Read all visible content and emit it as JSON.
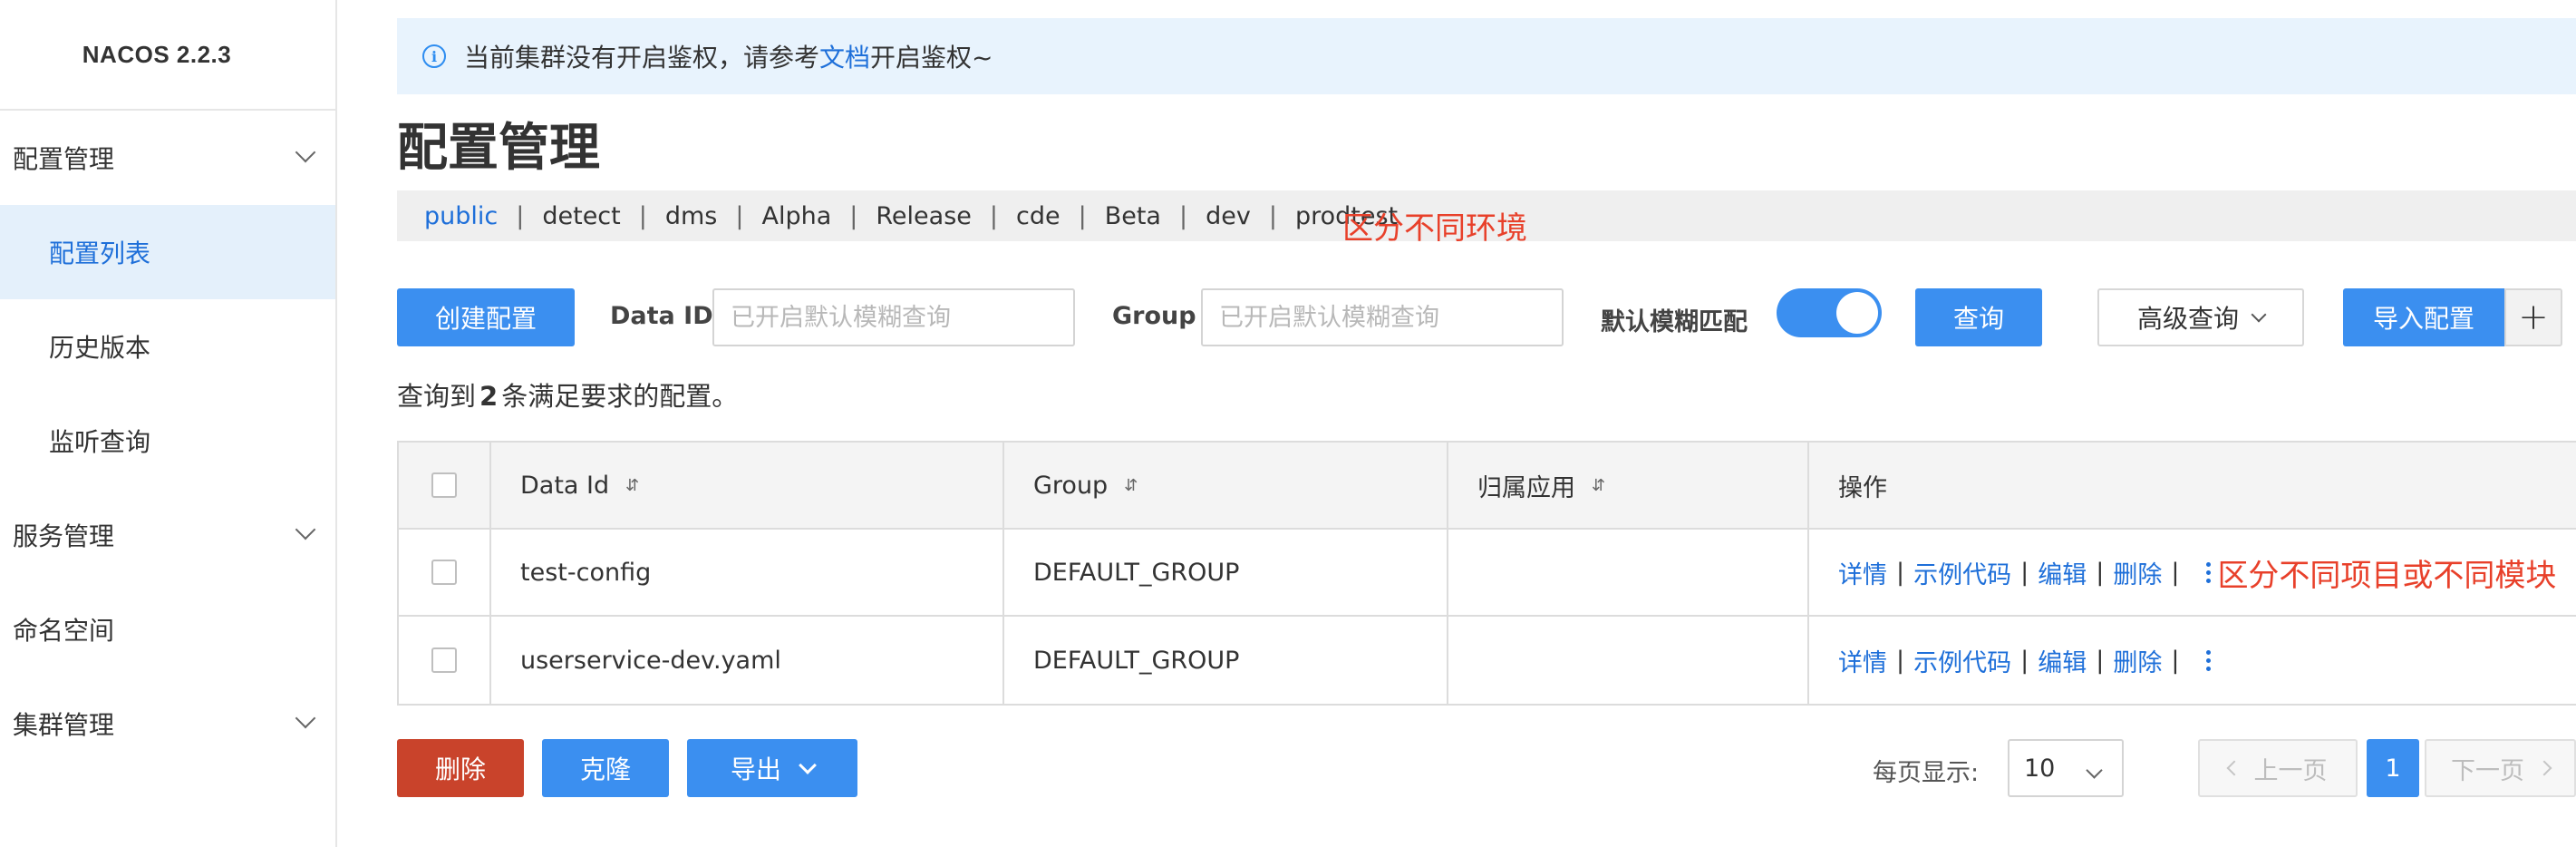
{
  "app": {
    "brand": "NACOS 2.2.3"
  },
  "sidebar": {
    "items": [
      {
        "label": "配置管理",
        "type": "group",
        "expanded": true
      },
      {
        "label": "配置列表",
        "type": "child",
        "active": true
      },
      {
        "label": "历史版本",
        "type": "child"
      },
      {
        "label": "监听查询",
        "type": "child"
      },
      {
        "label": "服务管理",
        "type": "group",
        "expanded": false
      },
      {
        "label": "命名空间",
        "type": "link"
      },
      {
        "label": "集群管理",
        "type": "group",
        "expanded": false
      }
    ]
  },
  "notice": {
    "prefix": "当前集群没有开启鉴权，请参考",
    "link": "文档",
    "suffix": "开启鉴权~"
  },
  "page": {
    "title": "配置管理"
  },
  "namespaces": {
    "items": [
      "public",
      "detect",
      "dms",
      "Alpha",
      "Release",
      "cde",
      "Beta",
      "dev",
      "prodtest"
    ],
    "active": "public",
    "separator": "|"
  },
  "annotations": {
    "namespaces": "区分不同环境",
    "operations": "区分不同项目或不同模块"
  },
  "toolbar": {
    "create_label": "创建配置",
    "dataid_label": "Data ID",
    "dataid_placeholder": "已开启默认模糊查询",
    "group_label": "Group",
    "group_placeholder": "已开启默认模糊查询",
    "fuzzy_label": "默认模糊匹配",
    "fuzzy_enabled": true,
    "query_label": "查询",
    "advanced_label": "高级查询",
    "import_label": "导入配置",
    "add_symbol": "+"
  },
  "summary": {
    "prefix": "查询到",
    "count": "2",
    "suffix": "条满足要求的配置。"
  },
  "table": {
    "headers": {
      "data_id": "Data Id",
      "group": "Group",
      "app": "归属应用",
      "ops": "操作"
    },
    "rows": [
      {
        "data_id": "test-config",
        "group": "DEFAULT_GROUP",
        "app": ""
      },
      {
        "data_id": "userservice-dev.yaml",
        "group": "DEFAULT_GROUP",
        "app": ""
      }
    ],
    "ops": {
      "detail": "详情",
      "sample": "示例代码",
      "edit": "编辑",
      "delete": "删除",
      "sep": "|"
    }
  },
  "bottom": {
    "delete_label": "删除",
    "clone_label": "克隆",
    "export_label": "导出",
    "page_size_label": "每页显示:",
    "page_size": "10",
    "prev_label": "上一页",
    "current_page": "1",
    "next_label": "下一页"
  },
  "colors": {
    "primary": "#3b8ff0",
    "danger": "#c9432b",
    "link": "#1e6fd9",
    "annotation": "#e8402a",
    "notice_bg": "#e8f3fd",
    "active_bg": "#e4f0fb"
  }
}
